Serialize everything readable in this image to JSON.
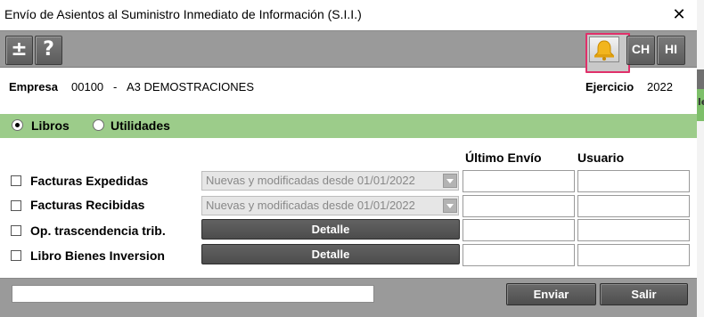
{
  "window": {
    "title": "Envío de Asientos al Suministro Inmediato de Información (S.I.I.)",
    "close_glyph": "✕"
  },
  "toolbar": {
    "plusminus_label": "±",
    "help_label": "?",
    "bell_icon": "bell-icon",
    "ch_label": "CH",
    "hi_label": "HI",
    "bell_highlight_color": "#e0306a"
  },
  "company": {
    "empresa_label": "Empresa",
    "empresa_code": "00100",
    "separator": "-",
    "empresa_name": "A3 DEMOSTRACIONES",
    "ejercicio_label": "Ejercicio",
    "ejercicio_value": "2022"
  },
  "mode": {
    "options": [
      {
        "label": "Libros",
        "selected": true
      },
      {
        "label": "Utilidades",
        "selected": false
      }
    ],
    "band_color": "#9ccc8a"
  },
  "columns": {
    "ultimo_envio": "Último Envío",
    "usuario": "Usuario"
  },
  "rows": [
    {
      "label": "Facturas Expedidas",
      "checked": false,
      "control": "combo",
      "value": "Nuevas y modificadas desde 01/01/2022",
      "ultimo_envio": "",
      "usuario": ""
    },
    {
      "label": "Facturas Recibidas",
      "checked": false,
      "control": "combo",
      "value": "Nuevas y modificadas desde 01/01/2022",
      "ultimo_envio": "",
      "usuario": ""
    },
    {
      "label": "Op. trascendencia trib.",
      "checked": false,
      "control": "button",
      "value": "Detalle",
      "ultimo_envio": "",
      "usuario": ""
    },
    {
      "label": "Libro Bienes Inversion",
      "checked": false,
      "control": "button",
      "value": "Detalle",
      "ultimo_envio": "",
      "usuario": ""
    }
  ],
  "footer": {
    "status_value": "",
    "enviar_label": "Enviar",
    "salir_label": "Salir"
  },
  "background_window": {
    "partial_text": "le"
  }
}
